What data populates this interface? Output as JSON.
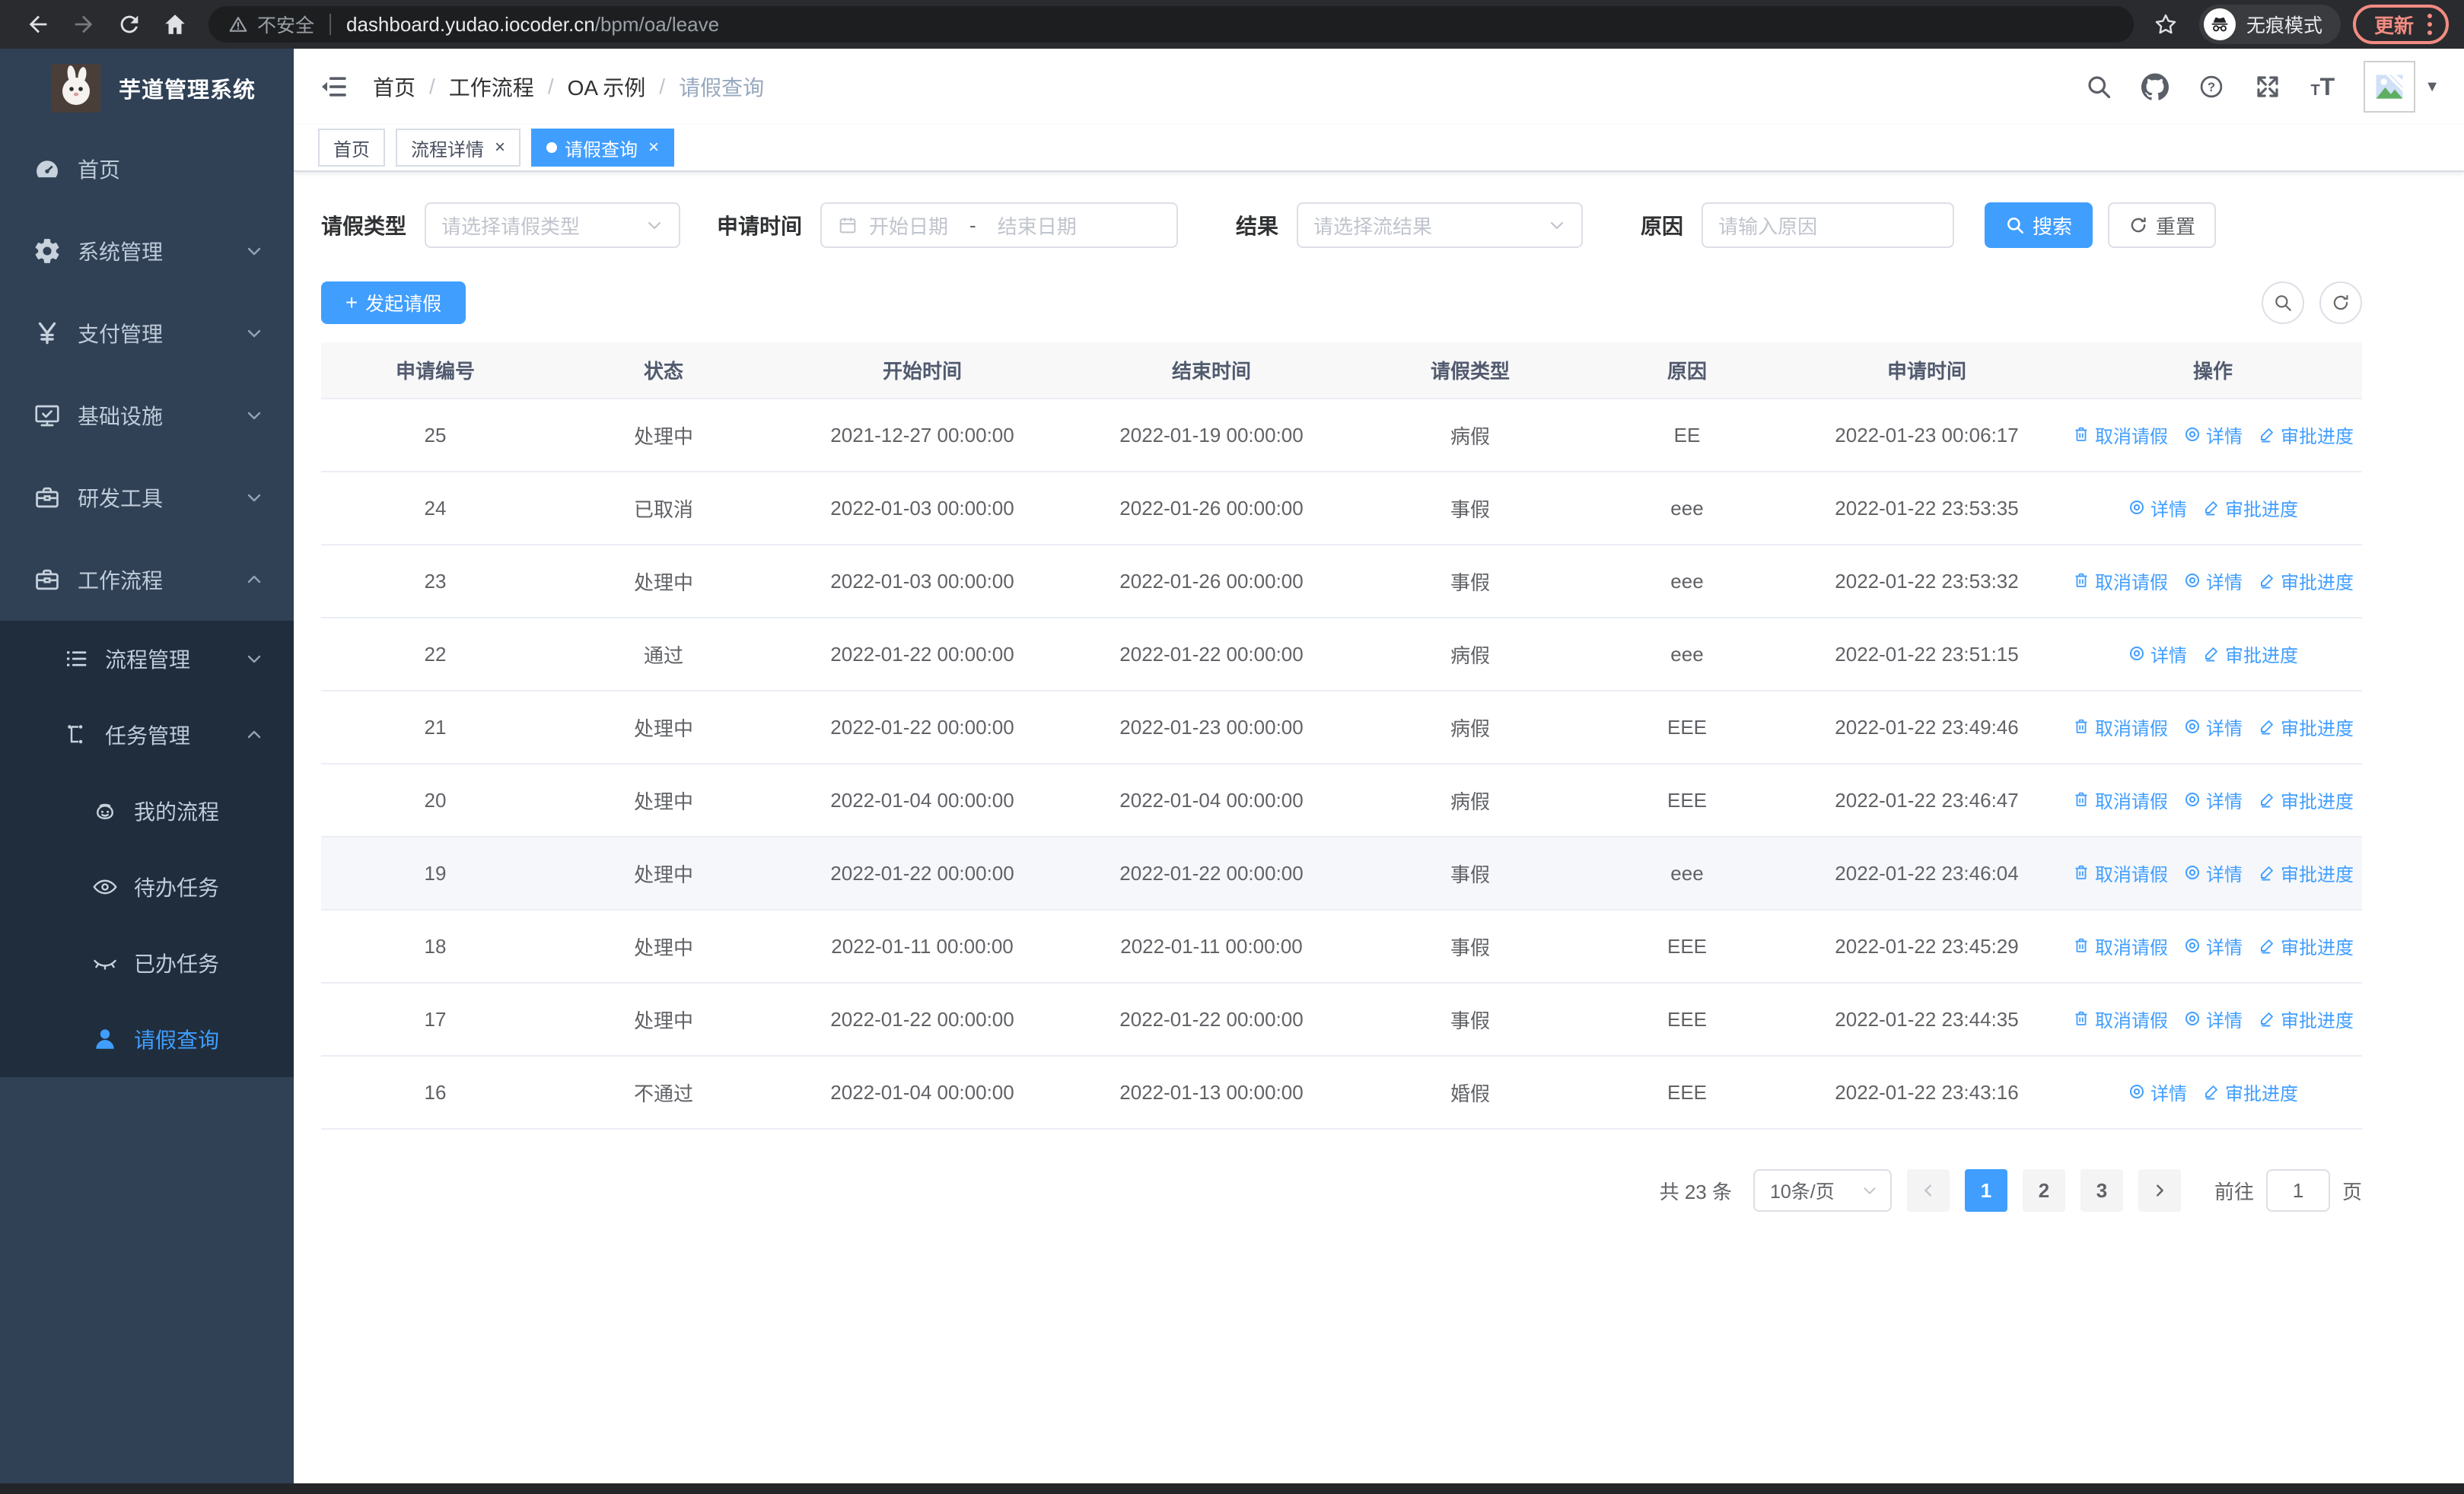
{
  "theme": {
    "primary": "#409eff",
    "sidebar_bg": "#304156",
    "submenu_bg": "#1f2d3d",
    "sidebar_text": "#bfcbd9",
    "chrome_bar_bg": "#2a2b2e",
    "update_accent": "#f28b82",
    "table_header_bg": "#f8f8f9",
    "link_blue": "#409eff"
  },
  "browser": {
    "security_label": "不安全",
    "url_host": "dashboard.yudao.iocoder.cn",
    "url_path": "/bpm/oa/leave",
    "incognito_label": "无痕模式",
    "update_label": "更新"
  },
  "sidebar": {
    "logo_title": "芋道管理系统",
    "items": [
      {
        "label": "首页",
        "icon": "dashboard-icon",
        "expandable": false
      },
      {
        "label": "系统管理",
        "icon": "gear-icon",
        "expandable": true,
        "state": "collapsed"
      },
      {
        "label": "支付管理",
        "icon": "yen-icon",
        "expandable": true,
        "state": "collapsed"
      },
      {
        "label": "基础设施",
        "icon": "monitor-check-icon",
        "expandable": true,
        "state": "collapsed"
      },
      {
        "label": "研发工具",
        "icon": "toolbox-icon",
        "expandable": true,
        "state": "collapsed"
      },
      {
        "label": "工作流程",
        "icon": "toolbox-icon",
        "expandable": true,
        "state": "expanded"
      }
    ],
    "submenu": [
      {
        "label": "流程管理",
        "icon": "list-icon",
        "state": "collapsed"
      },
      {
        "label": "任务管理",
        "icon": "tree-icon",
        "state": "expanded"
      }
    ],
    "task_children": [
      {
        "label": "我的流程",
        "icon": "robot-icon",
        "active": false
      },
      {
        "label": "待办任务",
        "icon": "eye-icon",
        "active": false
      },
      {
        "label": "已办任务",
        "icon": "eye-closed-icon",
        "active": false
      },
      {
        "label": "请假查询",
        "icon": "user-icon",
        "active": true
      }
    ]
  },
  "breadcrumb": {
    "items": [
      "首页",
      "工作流程",
      "OA 示例",
      "请假查询"
    ]
  },
  "tabs": [
    {
      "label": "首页",
      "closable": false,
      "active": false
    },
    {
      "label": "流程详情",
      "closable": true,
      "active": false
    },
    {
      "label": "请假查询",
      "closable": true,
      "active": true
    }
  ],
  "filters": {
    "leave_type_label": "请假类型",
    "leave_type_placeholder": "请选择请假类型",
    "apply_time_label": "申请时间",
    "start_date_placeholder": "开始日期",
    "range_separator": "-",
    "end_date_placeholder": "结束日期",
    "result_label": "结果",
    "result_placeholder": "请选择流结果",
    "reason_label": "原因",
    "reason_placeholder": "请输入原因",
    "search_button": "搜索",
    "reset_button": "重置"
  },
  "toolbar": {
    "create_button": "发起请假"
  },
  "table": {
    "headers": [
      "申请编号",
      "状态",
      "开始时间",
      "结束时间",
      "请假类型",
      "原因",
      "申请时间",
      "操作"
    ],
    "action_labels": {
      "cancel": "取消请假",
      "detail": "详情",
      "progress": "审批进度"
    },
    "rows": [
      {
        "id": "25",
        "status": "处理中",
        "start": "2021-12-27 00:00:00",
        "end": "2022-01-19 00:00:00",
        "type": "病假",
        "reason": "EE",
        "apply_time": "2022-01-23 00:06:17",
        "actions": [
          "cancel",
          "detail",
          "progress"
        ],
        "highlight": false
      },
      {
        "id": "24",
        "status": "已取消",
        "start": "2022-01-03 00:00:00",
        "end": "2022-01-26 00:00:00",
        "type": "事假",
        "reason": "eee",
        "apply_time": "2022-01-22 23:53:35",
        "actions": [
          "detail",
          "progress"
        ],
        "highlight": false
      },
      {
        "id": "23",
        "status": "处理中",
        "start": "2022-01-03 00:00:00",
        "end": "2022-01-26 00:00:00",
        "type": "事假",
        "reason": "eee",
        "apply_time": "2022-01-22 23:53:32",
        "actions": [
          "cancel",
          "detail",
          "progress"
        ],
        "highlight": false
      },
      {
        "id": "22",
        "status": "通过",
        "start": "2022-01-22 00:00:00",
        "end": "2022-01-22 00:00:00",
        "type": "病假",
        "reason": "eee",
        "apply_time": "2022-01-22 23:51:15",
        "actions": [
          "detail",
          "progress"
        ],
        "highlight": false
      },
      {
        "id": "21",
        "status": "处理中",
        "start": "2022-01-22 00:00:00",
        "end": "2022-01-23 00:00:00",
        "type": "病假",
        "reason": "EEE",
        "apply_time": "2022-01-22 23:49:46",
        "actions": [
          "cancel",
          "detail",
          "progress"
        ],
        "highlight": false
      },
      {
        "id": "20",
        "status": "处理中",
        "start": "2022-01-04 00:00:00",
        "end": "2022-01-04 00:00:00",
        "type": "病假",
        "reason": "EEE",
        "apply_time": "2022-01-22 23:46:47",
        "actions": [
          "cancel",
          "detail",
          "progress"
        ],
        "highlight": false
      },
      {
        "id": "19",
        "status": "处理中",
        "start": "2022-01-22 00:00:00",
        "end": "2022-01-22 00:00:00",
        "type": "事假",
        "reason": "eee",
        "apply_time": "2022-01-22 23:46:04",
        "actions": [
          "cancel",
          "detail",
          "progress"
        ],
        "highlight": true
      },
      {
        "id": "18",
        "status": "处理中",
        "start": "2022-01-11 00:00:00",
        "end": "2022-01-11 00:00:00",
        "type": "事假",
        "reason": "EEE",
        "apply_time": "2022-01-22 23:45:29",
        "actions": [
          "cancel",
          "detail",
          "progress"
        ],
        "highlight": false
      },
      {
        "id": "17",
        "status": "处理中",
        "start": "2022-01-22 00:00:00",
        "end": "2022-01-22 00:00:00",
        "type": "事假",
        "reason": "EEE",
        "apply_time": "2022-01-22 23:44:35",
        "actions": [
          "cancel",
          "detail",
          "progress"
        ],
        "highlight": false
      },
      {
        "id": "16",
        "status": "不通过",
        "start": "2022-01-04 00:00:00",
        "end": "2022-01-13 00:00:00",
        "type": "婚假",
        "reason": "EEE",
        "apply_time": "2022-01-22 23:43:16",
        "actions": [
          "detail",
          "progress"
        ],
        "highlight": false
      }
    ]
  },
  "pagination": {
    "total_label": "共 23 条",
    "page_size": "10条/页",
    "pages": [
      "1",
      "2",
      "3"
    ],
    "active_page": "1",
    "goto_label": "前往",
    "goto_value": "1",
    "page_unit": "页"
  }
}
